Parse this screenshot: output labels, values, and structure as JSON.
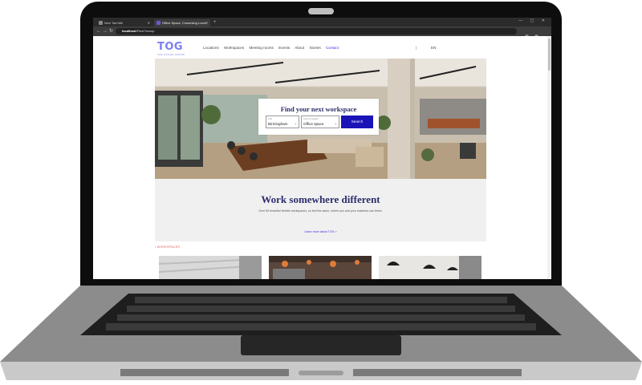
{
  "browser": {
    "tabs": [
      {
        "label": "New Tab/Idle"
      },
      {
        "label": "Office Space, Coworking Loca"
      }
    ],
    "new_tab": "+",
    "url_host": "localhost",
    "url_path": "/Find/?scoop"
  },
  "site": {
    "logo": "TOG",
    "logo_sub": "THE OFFICE GROUP",
    "nav": [
      "Locations",
      "Workspaces",
      "Meeting rooms",
      "Events",
      "About",
      "Stories",
      "Contact"
    ],
    "nav_sep": "|",
    "lang": "EN"
  },
  "search": {
    "title": "Find your next workspace",
    "city_label": "City",
    "city_value": "Birmingham",
    "type_label": "Type of space",
    "type_value": "Office space",
    "button": "Search"
  },
  "intro": {
    "title": "Work somewhere different",
    "text": "Over 50 beautiful flexible workspaces, so feel the same, where you and your business can thrive.",
    "link": "Learn more about TOG >"
  },
  "section_label": "/ WORKSPACES",
  "colors": {
    "accent": "#1a14b8",
    "logo": "#7b7ff0",
    "heading": "#2f2e6b"
  }
}
